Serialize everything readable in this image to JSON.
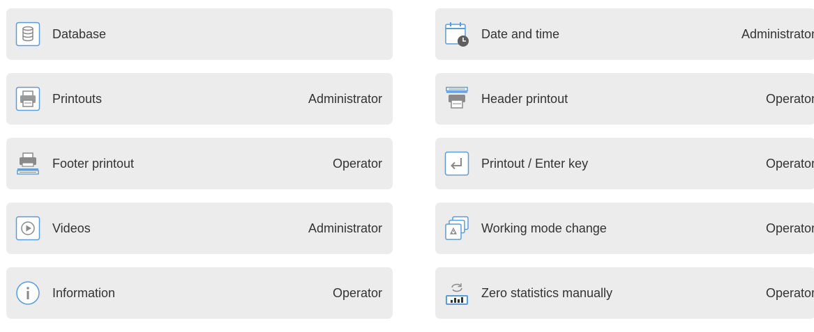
{
  "accent_color": "#4a90d9",
  "left": [
    {
      "icon": "database-icon",
      "label": "Database",
      "access": ""
    },
    {
      "icon": "printouts-icon",
      "label": "Printouts",
      "access": "Administrator"
    },
    {
      "icon": "footer-printout-icon",
      "label": "Footer printout",
      "access": "Operator"
    },
    {
      "icon": "videos-icon",
      "label": "Videos",
      "access": "Administrator"
    },
    {
      "icon": "information-icon",
      "label": "Information",
      "access": "Operator"
    }
  ],
  "right": [
    {
      "icon": "date-time-icon",
      "label": "Date and time",
      "access": "Administrator"
    },
    {
      "icon": "header-printout-icon",
      "label": "Header printout",
      "access": "Operator"
    },
    {
      "icon": "enter-key-icon",
      "label": "Printout / Enter key",
      "access": "Operator"
    },
    {
      "icon": "working-mode-icon",
      "label": "Working mode change",
      "access": "Operator"
    },
    {
      "icon": "zero-statistics-icon",
      "label": "Zero statistics manually",
      "access": "Operator"
    }
  ]
}
